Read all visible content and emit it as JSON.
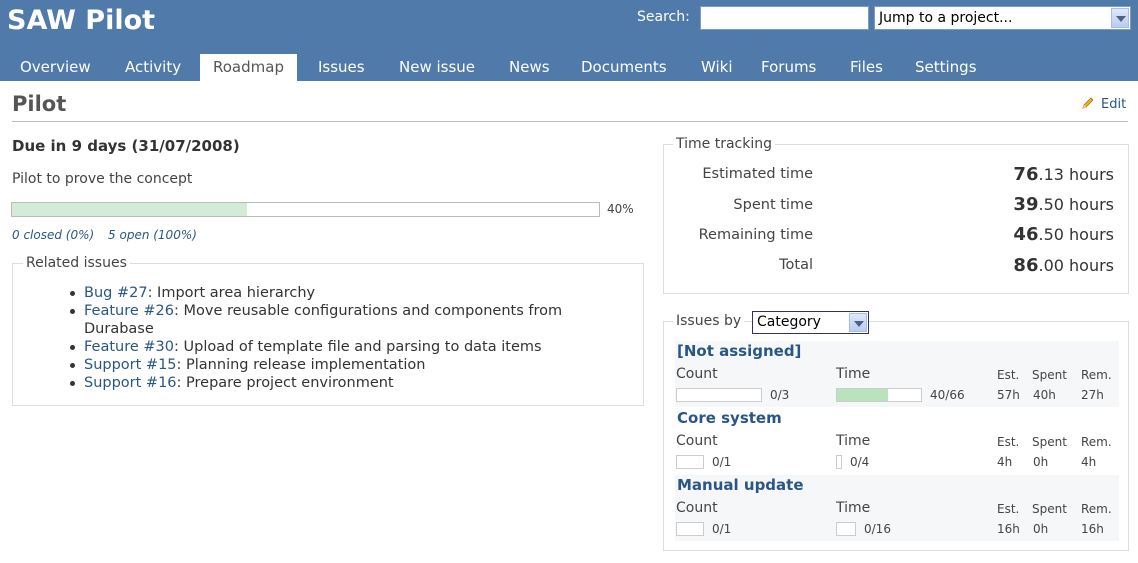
{
  "header": {
    "app_title": "SAW Pilot",
    "search_label": "Search:",
    "search_value": "",
    "jump_select": "Jump to a project..."
  },
  "menu": {
    "tabs": [
      {
        "label": "Overview"
      },
      {
        "label": "Activity"
      },
      {
        "label": "Roadmap",
        "selected": true
      },
      {
        "label": "Issues"
      },
      {
        "label": "New issue"
      },
      {
        "label": "News"
      },
      {
        "label": "Documents"
      },
      {
        "label": "Wiki"
      },
      {
        "label": "Forums"
      },
      {
        "label": "Files"
      },
      {
        "label": "Settings"
      }
    ]
  },
  "version": {
    "title": "Pilot",
    "edit_label": "Edit",
    "due": "Due in 9 days (31/07/2008)",
    "description": "Pilot to prove the concept",
    "progress_percent": 40,
    "progress_label": "40%",
    "closed_label": "0 closed (0%)",
    "open_label": "5 open (100%)"
  },
  "related": {
    "legend": "Related issues",
    "issues": [
      {
        "link": "Bug #27",
        "text": ": Import area hierarchy"
      },
      {
        "link": "Feature #26",
        "text": ": Move reusable configurations and components from Durabase"
      },
      {
        "link": "Feature #30",
        "text": ": Upload of template file and parsing to data items"
      },
      {
        "link": "Support #15",
        "text": ": Planning release implementation"
      },
      {
        "link": "Support #16",
        "text": ": Prepare project environment"
      }
    ]
  },
  "time_tracking": {
    "legend": "Time tracking",
    "rows": [
      {
        "label": "Estimated time",
        "int": "76",
        "dec": ".13 hours"
      },
      {
        "label": "Spent time",
        "int": "39",
        "dec": ".50 hours"
      },
      {
        "label": "Remaining time",
        "int": "46",
        "dec": ".50 hours"
      },
      {
        "label": "Total",
        "int": "86",
        "dec": ".00 hours"
      }
    ]
  },
  "by_category": {
    "legend": "Issues by",
    "selected": "Category",
    "headers": {
      "count": "Count",
      "time": "Time",
      "est": "Est.",
      "spent": "Spent",
      "rem": "Rem."
    },
    "categories": [
      {
        "name": "[Not assigned]",
        "count": "0/3",
        "count_fraction": 0,
        "time": "40/66",
        "time_fraction": 0.606,
        "est": "57h",
        "spent": "40h",
        "rem": "27h"
      },
      {
        "name": "Core system",
        "count": "0/1",
        "count_fraction": 0,
        "time": "0/4",
        "time_fraction": 0,
        "est": "4h",
        "spent": "0h",
        "rem": "4h"
      },
      {
        "name": "Manual update",
        "count": "0/1",
        "count_fraction": 0,
        "time": "0/16",
        "time_fraction": 0,
        "est": "16h",
        "spent": "0h",
        "rem": "16h"
      }
    ]
  }
}
